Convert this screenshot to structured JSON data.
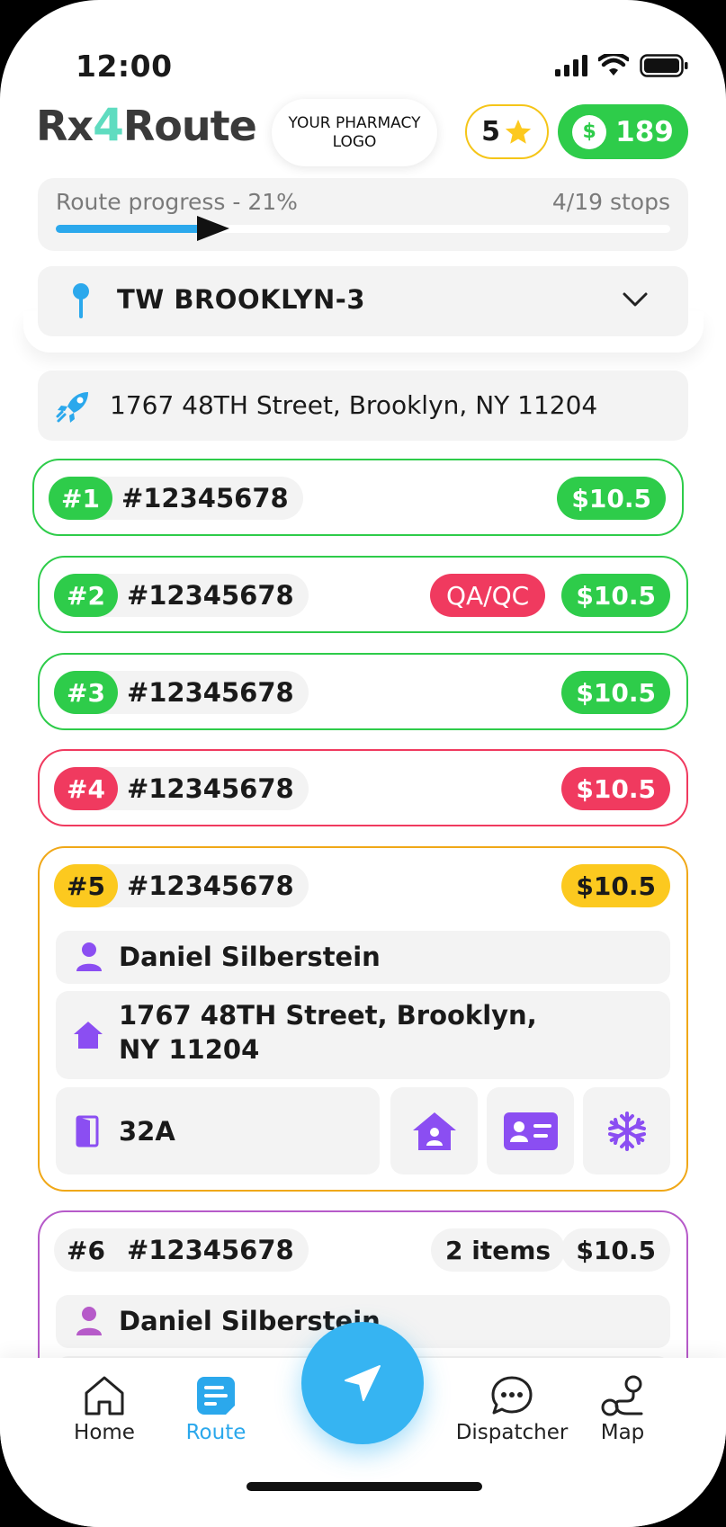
{
  "status_bar": {
    "time": "12:00"
  },
  "header": {
    "app_logo_prefix": "Rx",
    "app_logo_four": "4",
    "app_logo_suffix": "Route",
    "pharmacy_logo": "YOUR PHARMACY\nLOGO",
    "rating": "5",
    "balance": "189",
    "currency_symbol": "$"
  },
  "progress": {
    "label": "Route progress - 21%",
    "stops": "4/19 stops",
    "percent": 21
  },
  "route": {
    "name": "TW BROOKLYN-3"
  },
  "start": {
    "address": "1767 48TH Street, Brooklyn, NY 11204"
  },
  "colors": {
    "green": "#2ecc4a",
    "red": "#f03a5f",
    "yellow": "#fcc91f",
    "orange_border": "#f0a818",
    "purple": "#8b4ef2",
    "blue": "#36b4f2"
  },
  "stops": [
    {
      "number": "#1",
      "order": "#12345678",
      "price": "$10.5"
    },
    {
      "number": "#2",
      "order": "#12345678",
      "price": "$10.5",
      "tag": "QA/QC"
    },
    {
      "number": "#3",
      "order": "#12345678",
      "price": "$10.5"
    },
    {
      "number": "#4",
      "order": "#12345678",
      "price": "$10.5"
    },
    {
      "number": "#5",
      "order": "#12345678",
      "price": "$10.5",
      "customer": "Daniel Silberstein",
      "address_line1": "1767 48TH Street, Brooklyn,",
      "address_line2": "NY 11204",
      "apartment": "32A",
      "action_icons": [
        "house-icon",
        "id-card-icon",
        "snowflake-icon"
      ]
    },
    {
      "number": "#6",
      "order": "#12345678",
      "price": "$10.5",
      "items": "2 items",
      "customer": "Daniel Silberstein"
    }
  ],
  "nav": {
    "home": "Home",
    "route": "Route",
    "dispatcher": "Dispatcher",
    "map": "Map"
  }
}
